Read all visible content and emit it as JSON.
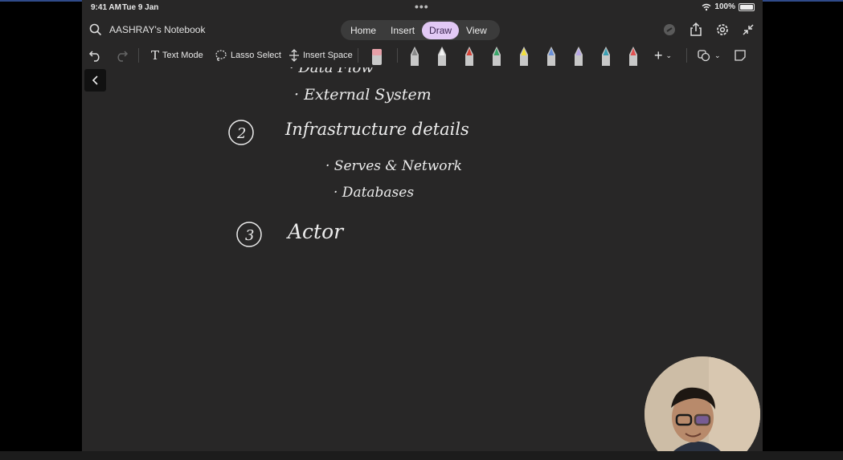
{
  "status": {
    "time": "9:41 AM",
    "date": "Tue 9 Jan",
    "battery": "100%",
    "dots": "•••"
  },
  "header": {
    "notebook_title": "AASHRAY's Notebook",
    "tabs": [
      {
        "label": "Home",
        "active": false
      },
      {
        "label": "Insert",
        "active": false
      },
      {
        "label": "Draw",
        "active": true
      },
      {
        "label": "View",
        "active": false
      }
    ],
    "icons": [
      "search-icon",
      "sync-icon",
      "share-icon",
      "settings-icon",
      "collapse-icon"
    ]
  },
  "toolbar": {
    "text_mode": "Text Mode",
    "lasso_select": "Lasso Select",
    "insert_space": "Insert Space",
    "pens": [
      {
        "name": "pencil-gray",
        "color": "#8a8a8a"
      },
      {
        "name": "pen-white",
        "color": "#f2f2f2"
      },
      {
        "name": "pen-red",
        "color": "#d6453a"
      },
      {
        "name": "pen-green",
        "color": "#3aa66a"
      },
      {
        "name": "highlighter-yellow",
        "color": "#f3e03a"
      },
      {
        "name": "pen-blue",
        "color": "#6a90d8"
      },
      {
        "name": "pen-lavender",
        "color": "#b7a6e6"
      },
      {
        "name": "pen-teal",
        "color": "#3a9fb3"
      },
      {
        "name": "pen-red-2",
        "color": "#e05050"
      }
    ]
  },
  "notes": {
    "line_cut": "· Data Flow",
    "external": "· External System",
    "num2": "2",
    "heading2": "Infrastructure details",
    "servers": "· Serves & Network",
    "databases": "· Databases",
    "num3": "3",
    "heading3": "Actor"
  },
  "colors": {
    "canvas": "#282727",
    "accent": "#e2c9f5"
  }
}
